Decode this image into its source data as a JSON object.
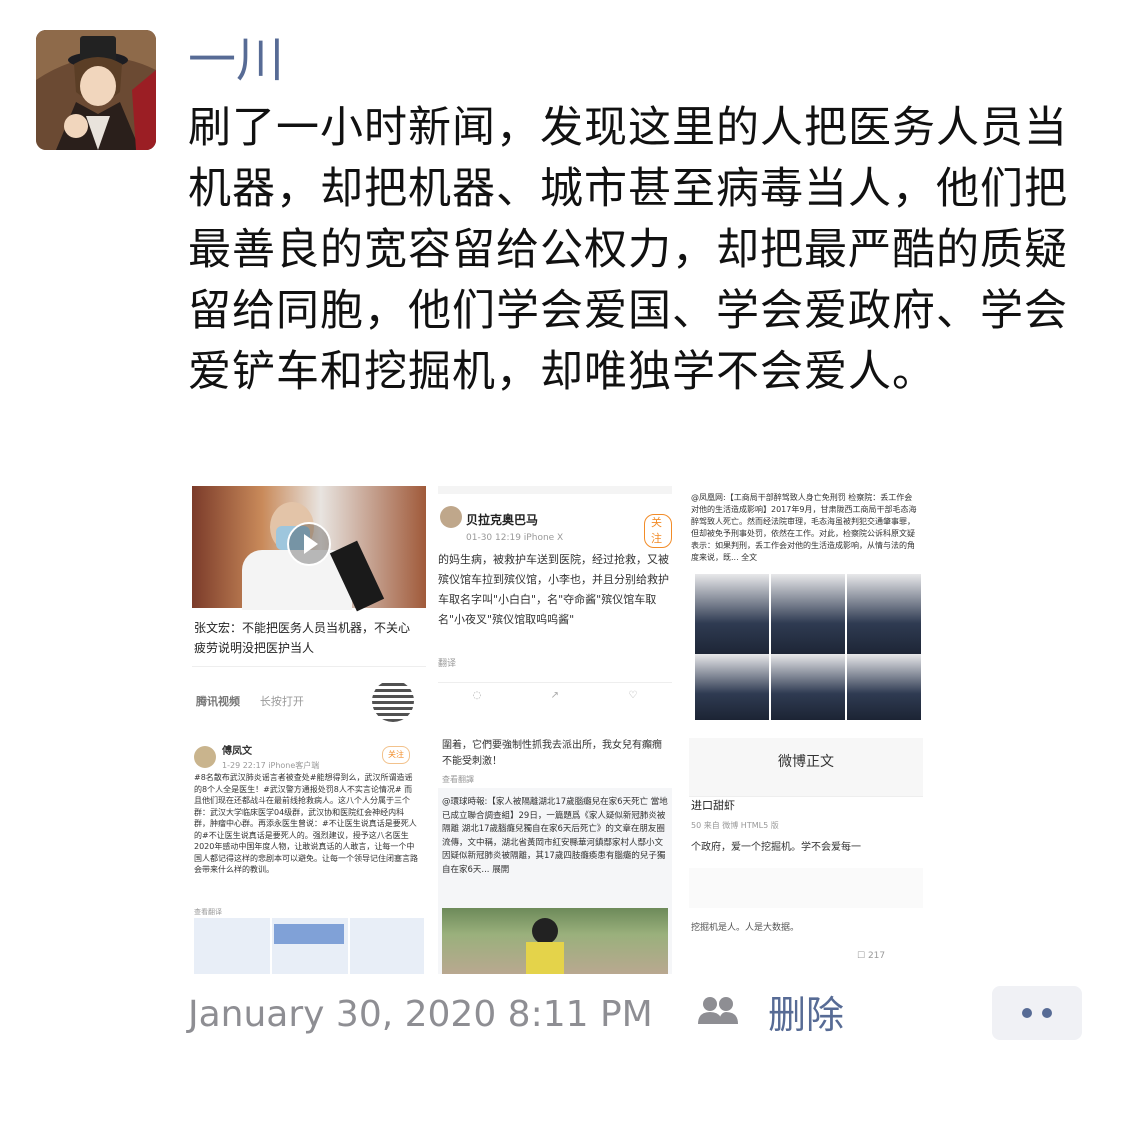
{
  "post": {
    "author": "一川",
    "text": "刷了一小时新闻，发现这里的人把医务人员当机器，却把机器、城市甚至病毒当人，他们把最善良的宽容留给公权力，却把最严酷的质疑留给同胞，他们学会爱国、学会爱政府、学会爱铲车和挖掘机，却唯独学不会爱人。",
    "timestamp": "January 30, 2020 8:11 PM",
    "delete_label": "删除"
  },
  "images": {
    "img1": {
      "caption": "张文宏：不能把医务人员当机器，不关心疲劳说明没把医护当人",
      "brand": "腾讯视频",
      "brand_hint": "长按打开"
    },
    "img2": {
      "user": "贝拉克奥巴马",
      "time": "01-30 12:19  iPhone X",
      "follow": "关注",
      "body": "的妈生病，被救护车送到医院，经过抢救，又被殡仪馆车拉到殡仪馆，小李也，并且分别给救护车取名字叫\"小白白\"，名\"夺命酱\"殡仪馆车取名\"小夜叉\"殡仪馆取呜呜酱\"",
      "translate": "翻译"
    },
    "img3": {
      "body": "@凤凰网:【工商局干部醉驾致人身亡免刑罚 检察院：丢工作会对他的生活造成影响】2017年9月，甘肃陇西工商局干部毛态海醉驾致人死亡。然而经法院审理，毛态海虽被判犯交通肇事罪，但却被免予刑事处罚，依然在工作。对此，检察院公诉科原文疑表示：如果判刑，丢工作会对他的生活造成影响，从情与法的角度来说，既... 全文"
    },
    "img4": {
      "user": "傅凤文",
      "time": "1-29 22:17  iPhone客户端",
      "follow": "关注",
      "body": "#8名散布武汉肺炎谣言者被查处#能想得到么，武汉所谓造谣的8个人全是医生！#武汉警方通报处罚8人不实言论情况# 而且他们现在还都战斗在最前线抢救病人。这八个人分属于三个群：武汉大学临床医学04级群，武汉协和医院红会神经内科群，肿瘤中心群。再添永医生曾说：#不让医生说真话是要死人的#不让医生说真话是要死人的。强烈建议，授予这八名医生2020年感动中国年度人物，让敢说真话的人敢言，让每一个中国人都记得这样的悲剧本可以避免。让每一个领导记住闭塞言路会带来什么样的教训。",
      "translate": "查看翻译"
    },
    "img5": {
      "top": "圍着，它們要強制性抓我去派出所，我女兒有癲癇不能受刺激！",
      "translate": "查看翻譯",
      "body": "@環球時報:【家人被隔離湖北17歲腦癱兒在家6天死亡 當地已成立聯合調查組】29日，一篇題爲《家人疑似新冠肺炎被隔離 湖北17歲腦癱兒獨自在家6天后死亡》的文章在朋友圈流傳，文中稱，湖北省黃岡市紅安縣華河鎮鄢家村人鄢小文因疑似新冠肺炎被隔離，其17歲四肢癱瘓患有腦癱的兒子獨自在家6天... 展開"
    },
    "img6": {
      "title": "微博正文",
      "user": "进口甜虾",
      "meta": "50  来自 微博 HTML5 版",
      "body1": "个政府，爱一个挖掘机。学不会爱每一",
      "body2": "挖掘机是人。人是大数据。",
      "count": "217"
    }
  },
  "colors": {
    "link_blue": "#576b95",
    "timestamp_gray": "#8e8e93",
    "more_bg": "#f0f1f5"
  },
  "icons": [
    "friends-visibility-icon",
    "play-icon",
    "qr-code-icon",
    "more-dots-icon"
  ]
}
